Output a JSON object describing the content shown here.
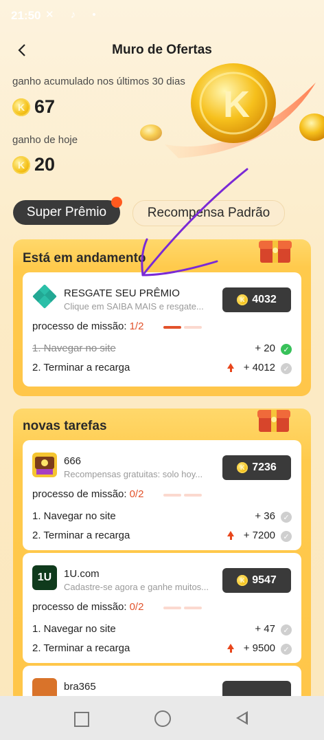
{
  "status_bar": {
    "time": "21:50",
    "icons": "✕ ♪ •"
  },
  "header": {
    "back_icon": "chevron-left-icon",
    "title": "Muro de Ofertas"
  },
  "stats": {
    "accumulated_label": "ganho acumulado nos últimos 30 dias",
    "accumulated_value": "67",
    "today_label": "ganho de hoje",
    "today_value": "20",
    "coin_symbol": "K"
  },
  "tabs": [
    {
      "label": "Super Prêmio",
      "active": true
    },
    {
      "label": "Recompensa Padrão",
      "active": false
    }
  ],
  "in_progress": {
    "title": "Está em andamento",
    "offer": {
      "name": "RESGATE SEU PRÊMIO",
      "description": "Clique em SAIBA MAIS e resgate...",
      "reward": "4032",
      "progress_label": "processo de missão:",
      "progress_value": "1/2",
      "progress_fraction": 0.5,
      "tasks": [
        {
          "label": "1. Navegar no site",
          "points": "+ 20",
          "done": true
        },
        {
          "label": "2. Terminar a recarga",
          "points": "+ 4012",
          "done": false
        }
      ]
    }
  },
  "new_tasks": {
    "title": "novas tarefas",
    "offers": [
      {
        "name": "666",
        "description": "Recompensas gratuitas: solo hoy...",
        "reward": "7236",
        "progress_label": "processo de missão:",
        "progress_value": "0/2",
        "progress_fraction": 0,
        "tasks": [
          {
            "label": "1. Navegar no site",
            "points": "+ 36"
          },
          {
            "label": "2. Terminar a recarga",
            "points": "+ 7200"
          }
        ]
      },
      {
        "name": "1U.com",
        "description": "Cadastre-se agora e ganhe muitos...",
        "reward": "9547",
        "progress_label": "processo de missão:",
        "progress_value": "0/2",
        "progress_fraction": 0,
        "icon_text": "1U",
        "tasks": [
          {
            "label": "1. Navegar no site",
            "points": "+ 47"
          },
          {
            "label": "2. Terminar a recarga",
            "points": "+ 9500"
          }
        ]
      },
      {
        "name": "bra365"
      }
    ]
  },
  "colors": {
    "accent": "#ffc64a",
    "dark": "#3a3a3a",
    "progress": "#e2522b",
    "check": "#38c15a"
  }
}
